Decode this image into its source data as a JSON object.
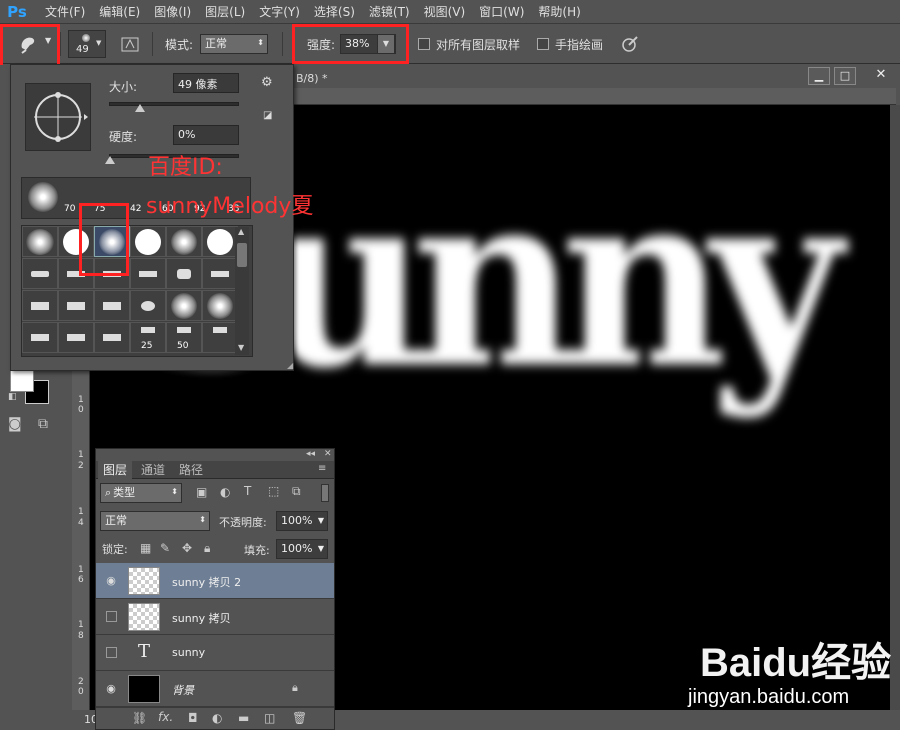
{
  "app": {
    "logo": "Ps"
  },
  "menu": [
    "文件(F)",
    "编辑(E)",
    "图像(I)",
    "图层(L)",
    "文字(Y)",
    "选择(S)",
    "滤镜(T)",
    "视图(V)",
    "窗口(W)",
    "帮助(H)"
  ],
  "options": {
    "brush_size": "49",
    "mode_label": "模式:",
    "mode_value": "正常",
    "strength_label": "强度:",
    "strength_value": "38%",
    "sample_all_label": "对所有图层取样",
    "finger_paint_label": "手指绘画"
  },
  "doc": {
    "title_fragment": "B/8) *",
    "zoom": "10"
  },
  "brush_popup": {
    "size_label": "大小:",
    "size_value": "49 像素",
    "hardness_label": "硬度:",
    "hardness_value": "0%",
    "recent_labels": [
      "70",
      "75",
      "42",
      "60",
      "92",
      "33"
    ],
    "grid_labels": [
      "25",
      "50"
    ]
  },
  "annotation": {
    "line1": "百度ID:",
    "line2": "sunnyMelody夏"
  },
  "canvas_text": "sunny",
  "layers": {
    "tabs": [
      "图层",
      "通道",
      "路径"
    ],
    "filter_kind": "类型",
    "blend_mode": "正常",
    "opacity_label": "不透明度:",
    "opacity_value": "100%",
    "lock_label": "锁定:",
    "fill_label": "填充:",
    "fill_value": "100%",
    "items": [
      {
        "name": "sunny 拷贝 2",
        "visible": true,
        "selected": true
      },
      {
        "name": "sunny 拷贝",
        "visible": false,
        "selected": false
      },
      {
        "name": "sunny",
        "visible": false,
        "selected": false
      },
      {
        "name": "背景",
        "visible": true,
        "selected": false
      }
    ]
  },
  "ruler_left": [
    "1",
    "0",
    "1",
    "2",
    "1",
    "4",
    "1",
    "6",
    "1",
    "8",
    "2",
    "0"
  ],
  "watermark": {
    "brand": "Baidu经验",
    "url": "jingyan.baidu.com"
  },
  "colors": {
    "accent_red": "#ff2222",
    "selected_layer": "#6e7f95",
    "annotation": "#ff3333"
  }
}
